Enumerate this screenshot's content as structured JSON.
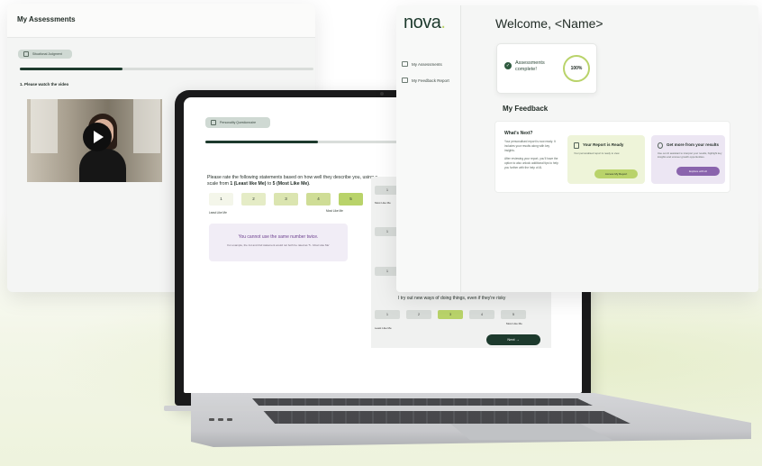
{
  "left_card": {
    "title": "My Assessments",
    "pill_label": "Situational Judgment",
    "progress": 0.35,
    "question": "1. Please watch the video"
  },
  "right_card": {
    "logo": "nova",
    "logo_dot": ".",
    "nav": [
      {
        "label": "My Assessments",
        "icon": "user-icon"
      },
      {
        "label": "My Feedback Report",
        "icon": "document-icon"
      }
    ],
    "welcome": "Welcome, <Name>",
    "complete_text": "Assessments complete!",
    "complete_percent": "100%",
    "feedback_title": "My Feedback",
    "next_title": "What's Next?",
    "next_body_1": "Your personalised report is now ready. It includes your results along with key insights.",
    "next_body_2": "After reviewing your report, you'll have the option to also unlock additional tips to help you further with the help of AI.",
    "report_card": {
      "title": "Your Report is Ready",
      "subtitle": "Your personalised report is ready to view.",
      "button": "Access My Report"
    },
    "more_card": {
      "title": "Get more from your results",
      "subtitle": "Use our AI assistant to interpret your results, highlight key insights and uncover growth opportunities.",
      "button": "Explore with AI"
    }
  },
  "laptop": {
    "pill_label": "Personality Questionnaire",
    "progress": 0.5,
    "instruction_a": "Please rate the following statements based on how well they describe you, using a scale from ",
    "instruction_b": "1 (Least like Me)",
    "instruction_c": " to ",
    "instruction_d": "5 (Most Like Me)",
    "instruction_e": ".",
    "scale": [
      "1",
      "2",
      "3",
      "4",
      "5"
    ],
    "scale_low": "Least Like Me",
    "scale_high": "Most Like Me",
    "warning_title": "You cannot use the same number twice.",
    "warning_body": "For example, the 1st and 2nd statement would not both be rated as '5 - Most Like Me'",
    "ghost_rows": [
      "1",
      "1",
      "1",
      "1"
    ],
    "ghost_label": "Most Like Me",
    "risk_question": "I try out new ways of doing things, even if they're risky",
    "risk_scale": [
      "1",
      "2",
      "3",
      "4",
      "5"
    ],
    "risk_low": "Least Like Me",
    "risk_high": "Most Like Me",
    "next_button": "Next →"
  },
  "colors": {
    "brand_dark": "#1d3a2d",
    "accent_lime": "#b9d36a",
    "accent_purple": "#8a64ad"
  }
}
